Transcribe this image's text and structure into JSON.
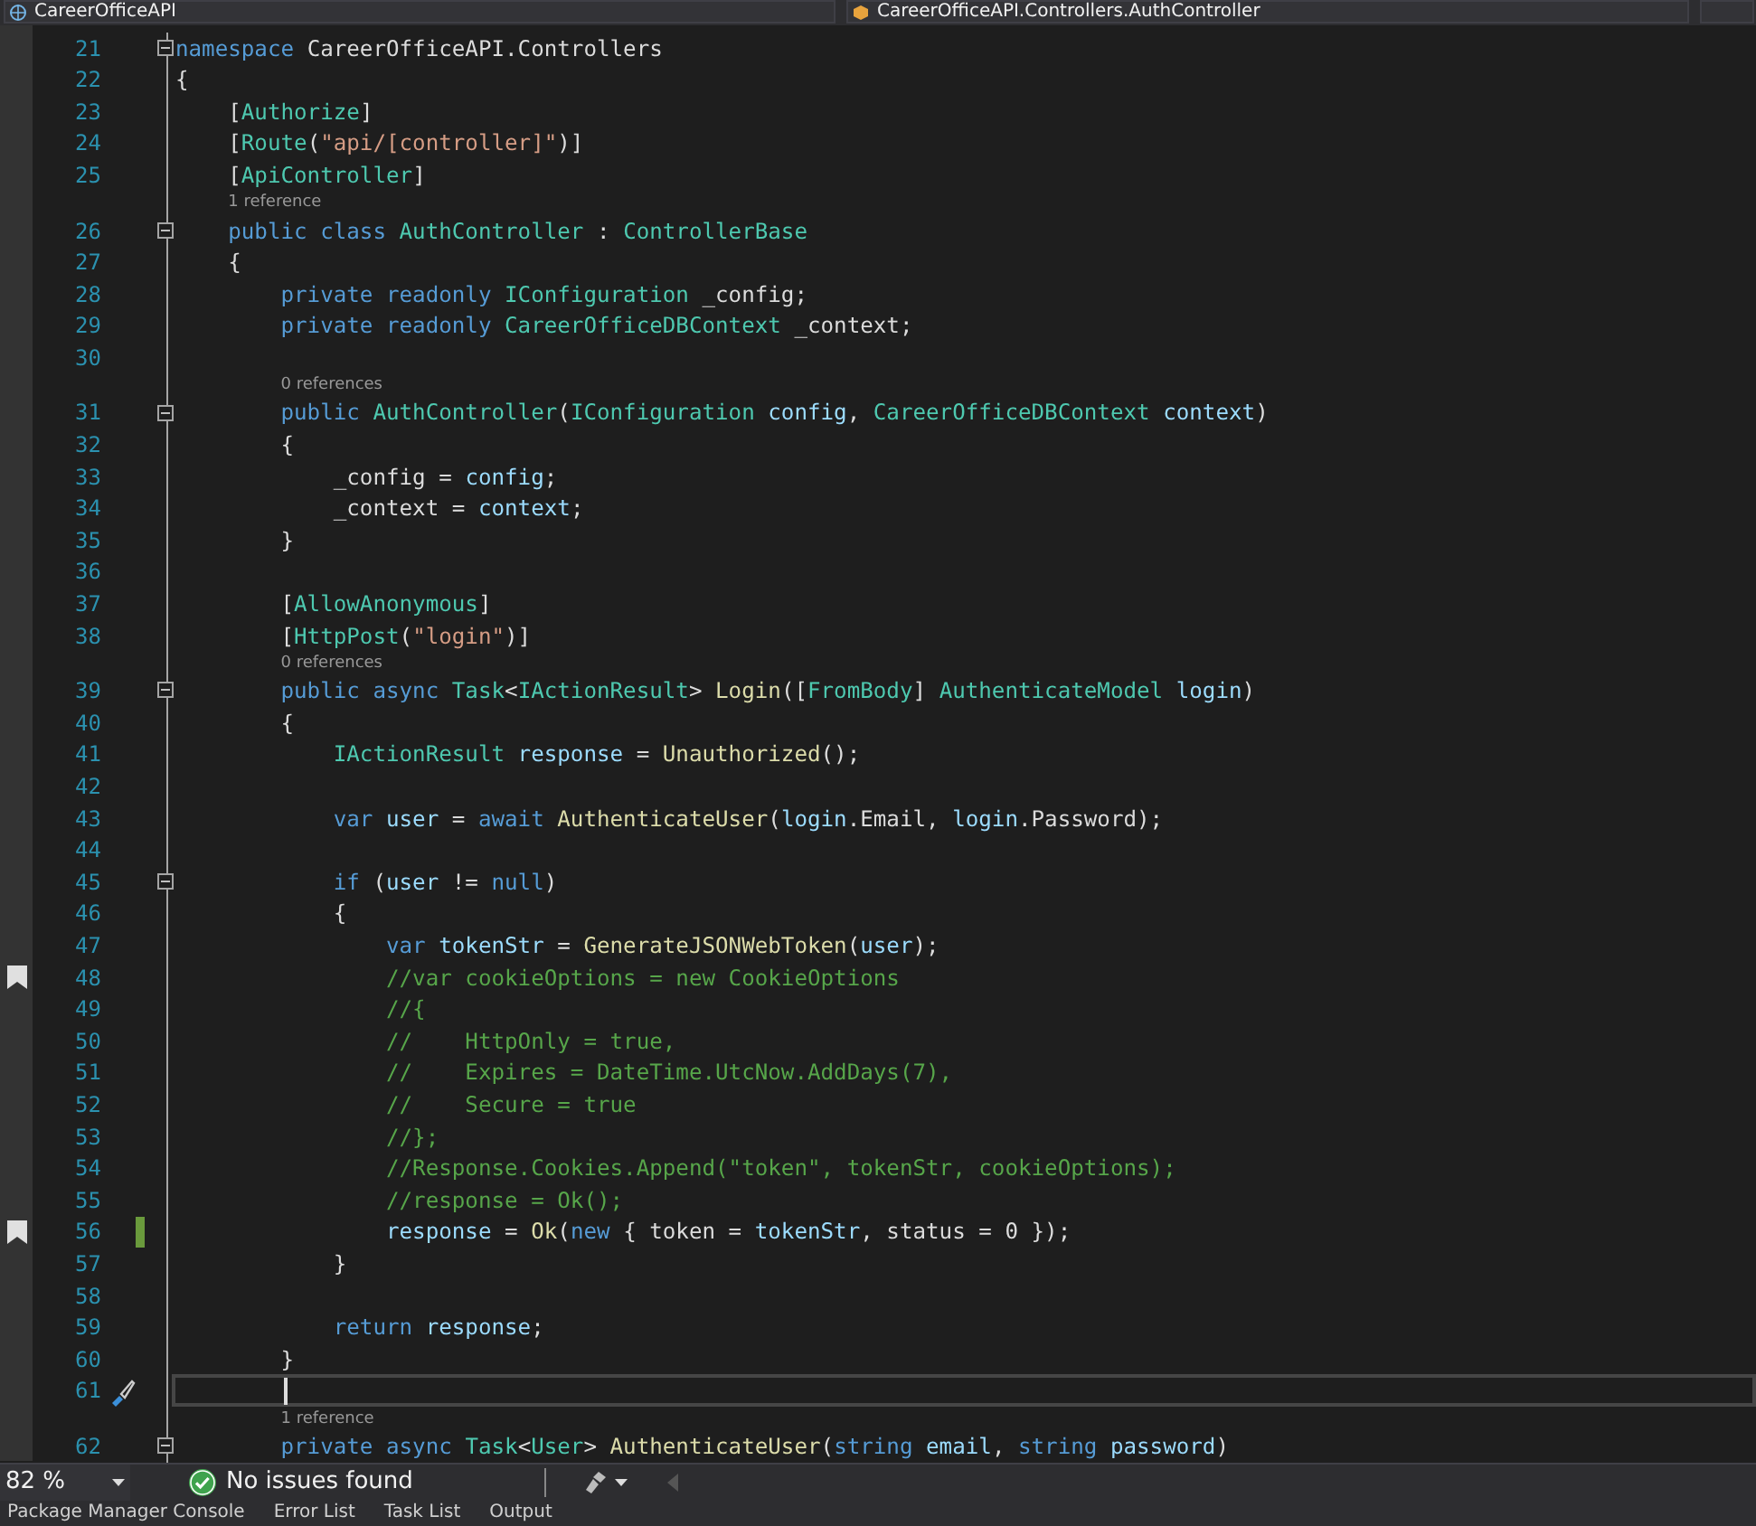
{
  "top_bar": {
    "project_dropdown": "CareerOfficeAPI",
    "type_dropdown": "CareerOfficeAPI.Controllers.AuthController"
  },
  "editor": {
    "rows": [
      {
        "kind": "code",
        "number": "21",
        "fold": true,
        "tokens": [
          {
            "t": "namespace ",
            "kind": "keyword"
          },
          {
            "t": "CareerOfficeAPI.Controllers",
            "kind": "plain"
          }
        ]
      },
      {
        "kind": "code",
        "number": "22",
        "tokens": [
          {
            "t": "{",
            "kind": "plain"
          }
        ]
      },
      {
        "kind": "code",
        "number": "23",
        "tokens": [
          {
            "t": "    [",
            "kind": "plain"
          },
          {
            "t": "Authorize",
            "kind": "type"
          },
          {
            "t": "]",
            "kind": "plain"
          }
        ]
      },
      {
        "kind": "code",
        "number": "24",
        "tokens": [
          {
            "t": "    [",
            "kind": "plain"
          },
          {
            "t": "Route",
            "kind": "type"
          },
          {
            "t": "(",
            "kind": "plain"
          },
          {
            "t": "\"api/[controller]\"",
            "kind": "string"
          },
          {
            "t": ")]",
            "kind": "plain"
          }
        ]
      },
      {
        "kind": "code",
        "number": "25",
        "tokens": [
          {
            "t": "    [",
            "kind": "plain"
          },
          {
            "t": "ApiController",
            "kind": "type"
          },
          {
            "t": "]",
            "kind": "plain"
          }
        ]
      },
      {
        "kind": "lens",
        "text": "1 reference"
      },
      {
        "kind": "code",
        "number": "26",
        "fold": true,
        "tokens": [
          {
            "t": "    public class ",
            "kind": "keyword"
          },
          {
            "t": "AuthController",
            "kind": "type"
          },
          {
            "t": " : ",
            "kind": "plain"
          },
          {
            "t": "ControllerBase",
            "kind": "type"
          }
        ]
      },
      {
        "kind": "code",
        "number": "27",
        "tokens": [
          {
            "t": "    {",
            "kind": "plain"
          }
        ]
      },
      {
        "kind": "code",
        "number": "28",
        "tokens": [
          {
            "t": "        private readonly ",
            "kind": "keyword"
          },
          {
            "t": "IConfiguration",
            "kind": "type"
          },
          {
            "t": " _config;",
            "kind": "plain"
          }
        ]
      },
      {
        "kind": "code",
        "number": "29",
        "tokens": [
          {
            "t": "        private readonly ",
            "kind": "keyword"
          },
          {
            "t": "CareerOfficeDBContext",
            "kind": "type"
          },
          {
            "t": " _context;",
            "kind": "plain"
          }
        ]
      },
      {
        "kind": "code",
        "number": "30"
      },
      {
        "kind": "lens",
        "text": "0 references"
      },
      {
        "kind": "code",
        "number": "31",
        "fold": true,
        "tokens": [
          {
            "t": "        public ",
            "kind": "keyword"
          },
          {
            "t": "AuthController",
            "kind": "type"
          },
          {
            "t": "(",
            "kind": "plain"
          },
          {
            "t": "IConfiguration",
            "kind": "type"
          },
          {
            "t": " config",
            "kind": "variable"
          },
          {
            "t": ", ",
            "kind": "plain"
          },
          {
            "t": "CareerOfficeDBContext",
            "kind": "type"
          },
          {
            "t": " context",
            "kind": "variable"
          },
          {
            "t": ")",
            "kind": "plain"
          }
        ]
      },
      {
        "kind": "code",
        "number": "32",
        "tokens": [
          {
            "t": "        {",
            "kind": "plain"
          }
        ]
      },
      {
        "kind": "code",
        "number": "33",
        "tokens": [
          {
            "t": "            _config = ",
            "kind": "plain"
          },
          {
            "t": "config",
            "kind": "variable"
          },
          {
            "t": ";",
            "kind": "plain"
          }
        ]
      },
      {
        "kind": "code",
        "number": "34",
        "tokens": [
          {
            "t": "            _context = ",
            "kind": "plain"
          },
          {
            "t": "context",
            "kind": "variable"
          },
          {
            "t": ";",
            "kind": "plain"
          }
        ]
      },
      {
        "kind": "code",
        "number": "35",
        "tokens": [
          {
            "t": "        }",
            "kind": "plain"
          }
        ]
      },
      {
        "kind": "code",
        "number": "36"
      },
      {
        "kind": "code",
        "number": "37",
        "tokens": [
          {
            "t": "        [",
            "kind": "plain"
          },
          {
            "t": "AllowAnonymous",
            "kind": "type"
          },
          {
            "t": "]",
            "kind": "plain"
          }
        ]
      },
      {
        "kind": "code",
        "number": "38",
        "tokens": [
          {
            "t": "        [",
            "kind": "plain"
          },
          {
            "t": "HttpPost",
            "kind": "type"
          },
          {
            "t": "(",
            "kind": "plain"
          },
          {
            "t": "\"login\"",
            "kind": "string"
          },
          {
            "t": ")]",
            "kind": "plain"
          }
        ]
      },
      {
        "kind": "lens",
        "text": "0 references"
      },
      {
        "kind": "code",
        "number": "39",
        "fold": true,
        "tokens": [
          {
            "t": "        public async ",
            "kind": "keyword"
          },
          {
            "t": "Task",
            "kind": "type"
          },
          {
            "t": "<",
            "kind": "plain"
          },
          {
            "t": "IActionResult",
            "kind": "type"
          },
          {
            "t": "> ",
            "kind": "plain"
          },
          {
            "t": "Login",
            "kind": "method"
          },
          {
            "t": "([",
            "kind": "plain"
          },
          {
            "t": "FromBody",
            "kind": "type"
          },
          {
            "t": "] ",
            "kind": "plain"
          },
          {
            "t": "AuthenticateModel",
            "kind": "type"
          },
          {
            "t": " login",
            "kind": "variable"
          },
          {
            "t": ")",
            "kind": "plain"
          }
        ]
      },
      {
        "kind": "code",
        "number": "40",
        "tokens": [
          {
            "t": "        {",
            "kind": "plain"
          }
        ]
      },
      {
        "kind": "code",
        "number": "41",
        "tokens": [
          {
            "t": "            IActionResult",
            "kind": "type"
          },
          {
            "t": " response",
            "kind": "variable"
          },
          {
            "t": " = ",
            "kind": "plain"
          },
          {
            "t": "Unauthorized",
            "kind": "method"
          },
          {
            "t": "();",
            "kind": "plain"
          }
        ]
      },
      {
        "kind": "code",
        "number": "42"
      },
      {
        "kind": "code",
        "number": "43",
        "tokens": [
          {
            "t": "            var ",
            "kind": "keyword"
          },
          {
            "t": "user",
            "kind": "variable"
          },
          {
            "t": " = ",
            "kind": "plain"
          },
          {
            "t": "await ",
            "kind": "keyword"
          },
          {
            "t": "AuthenticateUser",
            "kind": "method"
          },
          {
            "t": "(",
            "kind": "plain"
          },
          {
            "t": "login",
            "kind": "variable"
          },
          {
            "t": ".Email, ",
            "kind": "plain"
          },
          {
            "t": "login",
            "kind": "variable"
          },
          {
            "t": ".Password);",
            "kind": "plain"
          }
        ]
      },
      {
        "kind": "code",
        "number": "44"
      },
      {
        "kind": "code",
        "number": "45",
        "fold": true,
        "tokens": [
          {
            "t": "            if ",
            "kind": "keyword"
          },
          {
            "t": "(",
            "kind": "plain"
          },
          {
            "t": "user",
            "kind": "variable"
          },
          {
            "t": " != ",
            "kind": "plain"
          },
          {
            "t": "null",
            "kind": "keyword"
          },
          {
            "t": ")",
            "kind": "plain"
          }
        ]
      },
      {
        "kind": "code",
        "number": "46",
        "tokens": [
          {
            "t": "            {",
            "kind": "plain"
          }
        ]
      },
      {
        "kind": "code",
        "number": "47",
        "tokens": [
          {
            "t": "                var ",
            "kind": "keyword"
          },
          {
            "t": "tokenStr",
            "kind": "variable"
          },
          {
            "t": " = ",
            "kind": "plain"
          },
          {
            "t": "GenerateJSONWebToken",
            "kind": "method"
          },
          {
            "t": "(",
            "kind": "plain"
          },
          {
            "t": "user",
            "kind": "variable"
          },
          {
            "t": ");",
            "kind": "plain"
          }
        ]
      },
      {
        "kind": "code",
        "number": "48",
        "bookmark": true,
        "tokens": [
          {
            "t": "                //var cookieOptions = new CookieOptions",
            "kind": "comment"
          }
        ]
      },
      {
        "kind": "code",
        "number": "49",
        "tokens": [
          {
            "t": "                //{",
            "kind": "comment"
          }
        ]
      },
      {
        "kind": "code",
        "number": "50",
        "tokens": [
          {
            "t": "                //    HttpOnly = true,",
            "kind": "comment"
          }
        ]
      },
      {
        "kind": "code",
        "number": "51",
        "tokens": [
          {
            "t": "                //    Expires = DateTime.UtcNow.AddDays(7),",
            "kind": "comment"
          }
        ]
      },
      {
        "kind": "code",
        "number": "52",
        "tokens": [
          {
            "t": "                //    Secure = true",
            "kind": "comment"
          }
        ]
      },
      {
        "kind": "code",
        "number": "53",
        "tokens": [
          {
            "t": "                //};",
            "kind": "comment"
          }
        ]
      },
      {
        "kind": "code",
        "number": "54",
        "tokens": [
          {
            "t": "                //Response.Cookies.Append(\"token\", tokenStr, cookieOptions);",
            "kind": "comment"
          }
        ]
      },
      {
        "kind": "code",
        "number": "55",
        "tokens": [
          {
            "t": "                //response = Ok();",
            "kind": "comment"
          }
        ]
      },
      {
        "kind": "code",
        "number": "56",
        "bookmark": true,
        "changed": true,
        "tokens": [
          {
            "t": "                response",
            "kind": "variable"
          },
          {
            "t": " = ",
            "kind": "plain"
          },
          {
            "t": "Ok",
            "kind": "method"
          },
          {
            "t": "(",
            "kind": "plain"
          },
          {
            "t": "new ",
            "kind": "keyword"
          },
          {
            "t": "{ token = ",
            "kind": "plain"
          },
          {
            "t": "tokenStr",
            "kind": "variable"
          },
          {
            "t": ", status = 0 });",
            "kind": "plain"
          }
        ]
      },
      {
        "kind": "code",
        "number": "57",
        "tokens": [
          {
            "t": "            }",
            "kind": "plain"
          }
        ]
      },
      {
        "kind": "code",
        "number": "58"
      },
      {
        "kind": "code",
        "number": "59",
        "tokens": [
          {
            "t": "            return ",
            "kind": "keyword"
          },
          {
            "t": "response",
            "kind": "variable"
          },
          {
            "t": ";",
            "kind": "plain"
          }
        ]
      },
      {
        "kind": "code",
        "number": "60",
        "tokens": [
          {
            "t": "        }",
            "kind": "plain"
          }
        ]
      },
      {
        "kind": "code",
        "number": "61",
        "current": true,
        "quick_action": true
      },
      {
        "kind": "lens",
        "text": "1 reference"
      },
      {
        "kind": "code",
        "number": "62",
        "fold": true,
        "tokens": [
          {
            "t": "        private async ",
            "kind": "keyword"
          },
          {
            "t": "Task",
            "kind": "type"
          },
          {
            "t": "<",
            "kind": "plain"
          },
          {
            "t": "User",
            "kind": "type"
          },
          {
            "t": "> ",
            "kind": "plain"
          },
          {
            "t": "AuthenticateUser",
            "kind": "method"
          },
          {
            "t": "(",
            "kind": "plain"
          },
          {
            "t": "string ",
            "kind": "keyword"
          },
          {
            "t": "email",
            "kind": "variable"
          },
          {
            "t": ", ",
            "kind": "plain"
          },
          {
            "t": "string ",
            "kind": "keyword"
          },
          {
            "t": "password",
            "kind": "variable"
          },
          {
            "t": ")",
            "kind": "plain"
          }
        ]
      }
    ]
  },
  "status_bar": {
    "zoom": "82 %",
    "issues": "No issues found"
  },
  "tool_tabs": [
    "Package Manager Console",
    "Error List",
    "Task List",
    "Output"
  ]
}
